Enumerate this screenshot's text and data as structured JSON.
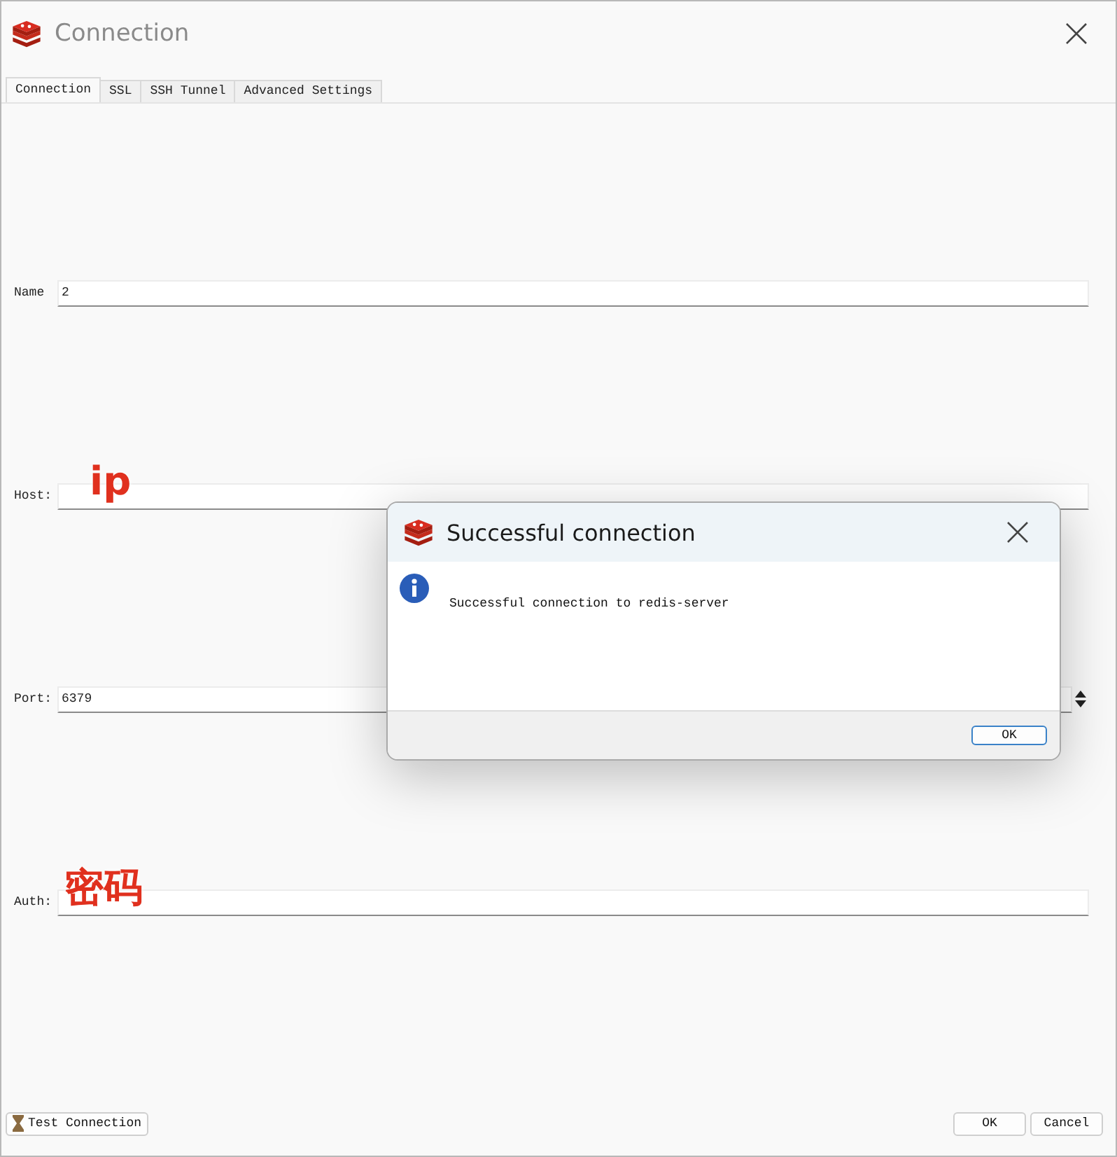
{
  "window": {
    "title": "Connection"
  },
  "tabs": [
    {
      "label": "Connection",
      "selected": true
    },
    {
      "label": "SSL",
      "selected": false
    },
    {
      "label": "SSH Tunnel",
      "selected": false
    },
    {
      "label": "Advanced Settings",
      "selected": false
    }
  ],
  "fields": [
    {
      "kind": "text",
      "label": "Name",
      "value": "2"
    },
    {
      "kind": "text",
      "label": "Host:",
      "annotation": "ip"
    },
    {
      "kind": "spin",
      "label": "Port:",
      "value": "6379"
    },
    {
      "kind": "text",
      "label": "Auth:",
      "annotation": "密码"
    }
  ],
  "footer": {
    "test_button": "Test Connection",
    "buttons": [
      "OK",
      "Cancel"
    ]
  },
  "dialog": {
    "title": "Successful connection",
    "message": "Successful connection to redis-server",
    "button": "OK"
  }
}
